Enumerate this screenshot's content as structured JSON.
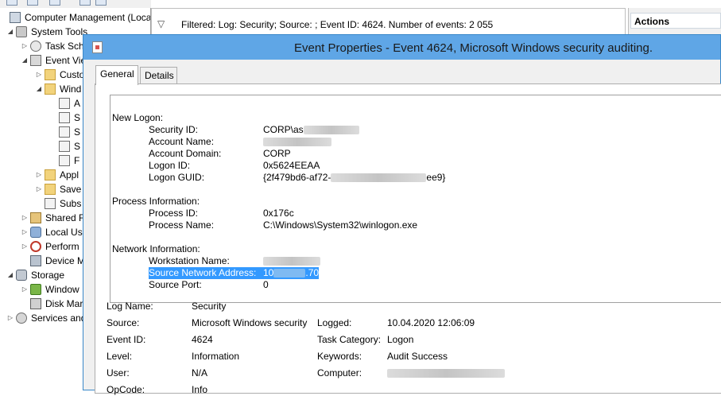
{
  "tree": {
    "items": [
      {
        "label": "Computer Management (Local",
        "icon": "computer-icon",
        "expander": ""
      },
      {
        "label": "System Tools",
        "icon": "tools-icon",
        "expander": "◢"
      },
      {
        "label": "Task Sch",
        "icon": "clock-icon",
        "expander": "▷"
      },
      {
        "label": "Event Vie",
        "icon": "event-viewer-icon",
        "expander": "◢"
      },
      {
        "label": "Custo",
        "icon": "folder-icon",
        "expander": "▷"
      },
      {
        "label": "Wind",
        "icon": "folder-icon",
        "expander": "◢"
      },
      {
        "label": "A",
        "icon": "log-icon",
        "expander": ""
      },
      {
        "label": "S",
        "icon": "log-icon",
        "expander": ""
      },
      {
        "label": "S",
        "icon": "log-icon",
        "expander": ""
      },
      {
        "label": "S",
        "icon": "log-icon",
        "expander": ""
      },
      {
        "label": "F",
        "icon": "log-icon",
        "expander": ""
      },
      {
        "label": "Appl",
        "icon": "folder-icon",
        "expander": "▷"
      },
      {
        "label": "Save",
        "icon": "folder-icon",
        "expander": "▷"
      },
      {
        "label": "Subs",
        "icon": "log-icon",
        "expander": ""
      },
      {
        "label": "Shared F",
        "icon": "shared-folder-icon",
        "expander": "▷"
      },
      {
        "label": "Local Us",
        "icon": "users-icon",
        "expander": "▷"
      },
      {
        "label": "Perform",
        "icon": "performance-icon",
        "expander": "▷"
      },
      {
        "label": "Device M",
        "icon": "device-manager-icon",
        "expander": ""
      },
      {
        "label": "Storage",
        "icon": "storage-icon",
        "expander": "◢"
      },
      {
        "label": "Window",
        "icon": "backup-icon",
        "expander": "▷"
      },
      {
        "label": "Disk Mar",
        "icon": "disk-icon",
        "expander": ""
      },
      {
        "label": "Services and",
        "icon": "services-icon",
        "expander": "▷"
      }
    ]
  },
  "filter": {
    "icon": "filter-icon",
    "text": "Filtered: Log: Security; Source: ; Event ID: 4624. Number of events: 2 055"
  },
  "actions": {
    "header": "Actions"
  },
  "dialog": {
    "title": "Event Properties - Event 4624, Microsoft Windows security auditing.",
    "tabs": {
      "general": "General",
      "details": "Details"
    },
    "message": {
      "new_logon": "New Logon:",
      "security_id_label": "Security ID:",
      "security_id_value": "CORP\\as",
      "account_name_label": "Account Name:",
      "account_domain_label": "Account Domain:",
      "account_domain_value": "CORP",
      "logon_id_label": "Logon ID:",
      "logon_id_value": "0x5624EEAA",
      "logon_guid_label": "Logon GUID:",
      "logon_guid_start": "{2f479bd6-af72-",
      "logon_guid_end": "ee9}",
      "process_info": "Process Information:",
      "process_id_label": "Process ID:",
      "process_id_value": "0x176c",
      "process_name_label": "Process Name:",
      "process_name_value": "C:\\Windows\\System32\\winlogon.exe",
      "network_info": "Network Information:",
      "workstation_label": "Workstation Name:",
      "source_address_label": "Source Network Address:",
      "source_address_start": "10",
      "source_address_end": ".70",
      "source_port_label": "Source Port:",
      "source_port_value": "0"
    },
    "details": {
      "log_name_label": "Log Name:",
      "log_name_value": "Security",
      "source_label": "Source:",
      "source_value": "Microsoft Windows security",
      "logged_label": "Logged:",
      "logged_value": "10.04.2020 12:06:09",
      "event_id_label": "Event ID:",
      "event_id_value": "4624",
      "task_category_label": "Task Category:",
      "task_category_value": "Logon",
      "level_label": "Level:",
      "level_value": "Information",
      "keywords_label": "Keywords:",
      "keywords_value": "Audit Success",
      "user_label": "User:",
      "user_value": "N/A",
      "computer_label": "Computer:",
      "opcode_label": "OpCode:",
      "opcode_value": "Info"
    }
  },
  "colors": {
    "title_bar": "#5fa6e6",
    "selection": "#3399ff"
  }
}
